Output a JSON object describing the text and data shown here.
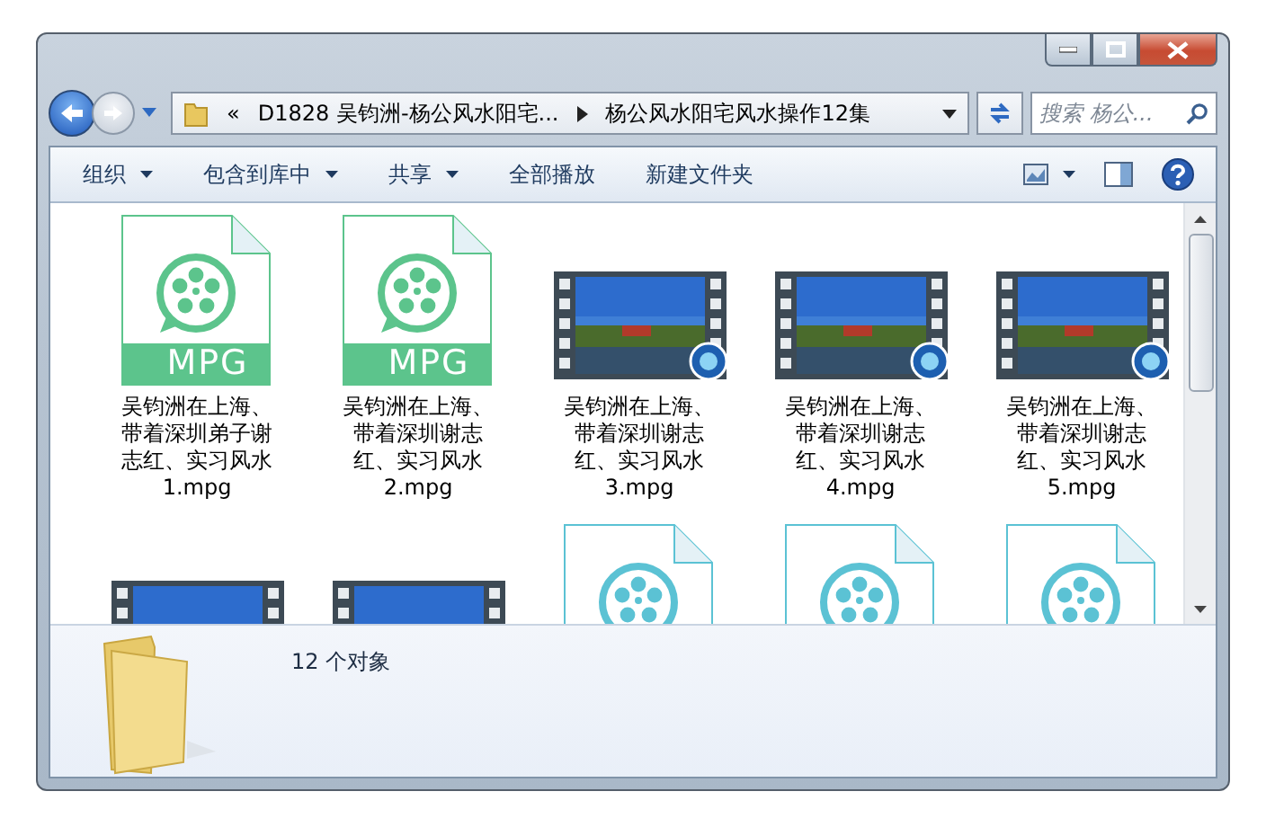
{
  "address_bar": {
    "overflow": "«",
    "segments": [
      "D1828 吴钧洲-杨公风水阳宅...",
      "杨公风水阳宅风水操作12集"
    ]
  },
  "search": {
    "placeholder": "搜索 杨公..."
  },
  "toolbar": [
    {
      "label": "组织",
      "has_menu": true
    },
    {
      "label": "包含到库中",
      "has_menu": true
    },
    {
      "label": "共享",
      "has_menu": true
    },
    {
      "label": "全部播放",
      "has_menu": false
    },
    {
      "label": "新建文件夹",
      "has_menu": false
    }
  ],
  "files": [
    {
      "kind": "mpg-doc",
      "badge": "MPG",
      "name": "吴钧洲在上海、带着深圳弟子谢志红、实习风水1.mpg"
    },
    {
      "kind": "mpg-doc",
      "badge": "MPG",
      "name": "吴钧洲在上海、带着深圳谢志红、实习风水2.mpg"
    },
    {
      "kind": "video-thumb",
      "name": "吴钧洲在上海、带着深圳谢志红、实习风水3.mpg"
    },
    {
      "kind": "video-thumb",
      "name": "吴钧洲在上海、带着深圳谢志红、实习风水4.mpg"
    },
    {
      "kind": "video-thumb",
      "name": "吴钧洲在上海、带着深圳谢志红、实习风水5.mpg"
    },
    {
      "kind": "video-thumb"
    },
    {
      "kind": "video-thumb"
    },
    {
      "kind": "media-doc"
    },
    {
      "kind": "media-doc"
    },
    {
      "kind": "media-doc"
    }
  ],
  "details": {
    "count": "12 个对象"
  }
}
